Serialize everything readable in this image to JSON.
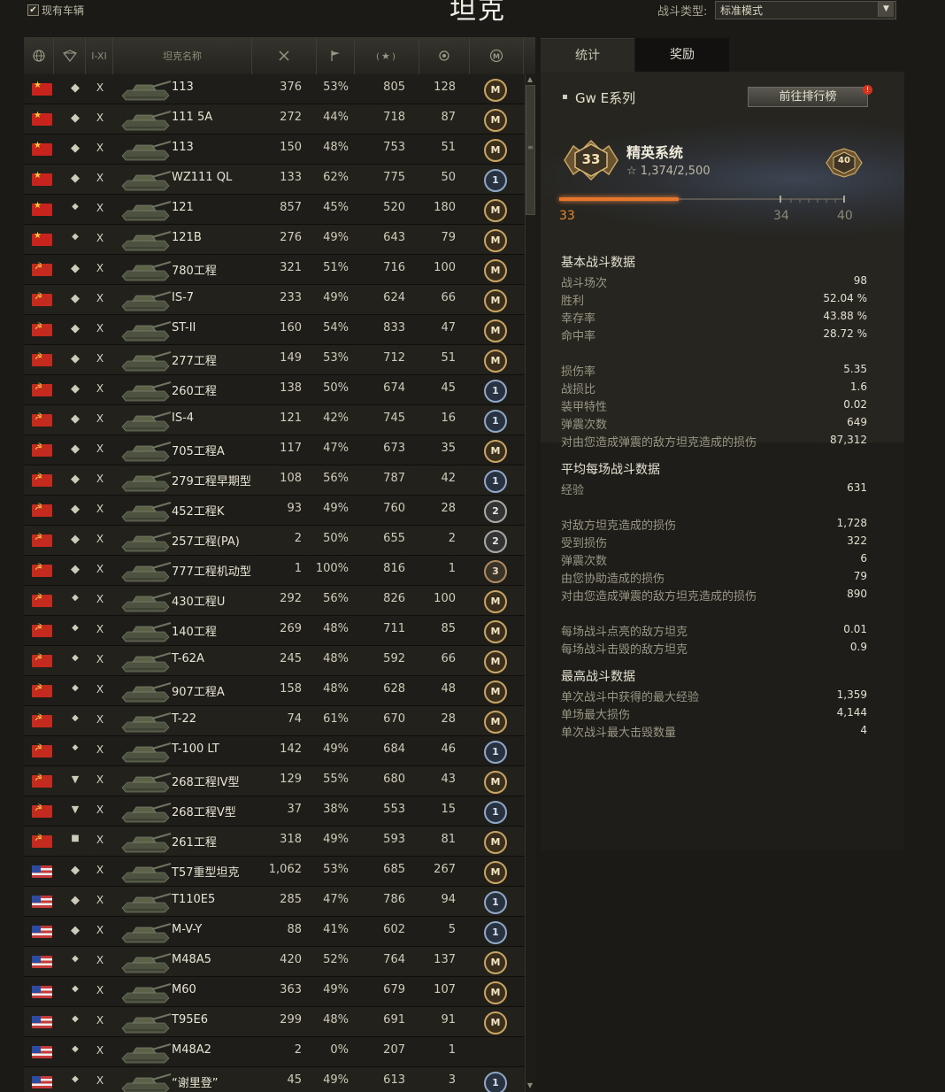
{
  "header": {
    "owned_only_label": "现有车辆",
    "owned_only_checked": "✔",
    "page_title": "坦克",
    "battle_type_label": "战斗类型:",
    "battle_type_value": "标准模式"
  },
  "table": {
    "columns": [
      "nation-globe-icon",
      "class-filter-icon",
      "I-XI",
      "坦克名称",
      "battles-icon",
      "win-flag-icon",
      "avg-xp-icon",
      "mastery-count-icon",
      "mastery-badge-icon"
    ],
    "tier_header": "I-XI",
    "name_header": "坦克名称",
    "rows": [
      {
        "nation": "china",
        "class": "heavy",
        "tier": "X",
        "name": "113",
        "battles": "376",
        "win": "53%",
        "xp": "805",
        "mastery": "128",
        "badge": "M"
      },
      {
        "nation": "china",
        "class": "heavy",
        "tier": "X",
        "name": "111 5A",
        "battles": "272",
        "win": "44%",
        "xp": "718",
        "mastery": "87",
        "badge": "M"
      },
      {
        "nation": "china",
        "class": "heavy",
        "tier": "X",
        "name": "113",
        "battles": "150",
        "win": "48%",
        "xp": "753",
        "mastery": "51",
        "badge": "M"
      },
      {
        "nation": "china",
        "class": "heavy",
        "tier": "X",
        "name": "WZ111 QL",
        "battles": "133",
        "win": "62%",
        "xp": "775",
        "mastery": "50",
        "badge": "1"
      },
      {
        "nation": "china",
        "class": "medium",
        "tier": "X",
        "name": "121",
        "battles": "857",
        "win": "45%",
        "xp": "520",
        "mastery": "180",
        "badge": "M"
      },
      {
        "nation": "china",
        "class": "medium",
        "tier": "X",
        "name": "121B",
        "battles": "276",
        "win": "49%",
        "xp": "643",
        "mastery": "79",
        "badge": "M"
      },
      {
        "nation": "ussr",
        "class": "heavy",
        "tier": "X",
        "name": "780工程",
        "battles": "321",
        "win": "51%",
        "xp": "716",
        "mastery": "100",
        "badge": "M"
      },
      {
        "nation": "ussr",
        "class": "heavy",
        "tier": "X",
        "name": "IS-7",
        "battles": "233",
        "win": "49%",
        "xp": "624",
        "mastery": "66",
        "badge": "M"
      },
      {
        "nation": "ussr",
        "class": "heavy",
        "tier": "X",
        "name": "ST-II",
        "battles": "160",
        "win": "54%",
        "xp": "833",
        "mastery": "47",
        "badge": "M"
      },
      {
        "nation": "ussr",
        "class": "heavy",
        "tier": "X",
        "name": "277工程",
        "battles": "149",
        "win": "53%",
        "xp": "712",
        "mastery": "51",
        "badge": "M"
      },
      {
        "nation": "ussr",
        "class": "heavy",
        "tier": "X",
        "name": "260工程",
        "battles": "138",
        "win": "50%",
        "xp": "674",
        "mastery": "45",
        "badge": "1"
      },
      {
        "nation": "ussr",
        "class": "heavy",
        "tier": "X",
        "name": "IS-4",
        "battles": "121",
        "win": "42%",
        "xp": "745",
        "mastery": "16",
        "badge": "1"
      },
      {
        "nation": "ussr",
        "class": "heavy",
        "tier": "X",
        "name": "705工程A",
        "battles": "117",
        "win": "47%",
        "xp": "673",
        "mastery": "35",
        "badge": "M"
      },
      {
        "nation": "ussr",
        "class": "heavy",
        "tier": "X",
        "name": "279工程早期型",
        "battles": "108",
        "win": "56%",
        "xp": "787",
        "mastery": "42",
        "badge": "1"
      },
      {
        "nation": "ussr",
        "class": "heavy",
        "tier": "X",
        "name": "452工程K",
        "battles": "93",
        "win": "49%",
        "xp": "760",
        "mastery": "28",
        "badge": "2"
      },
      {
        "nation": "ussr",
        "class": "heavy",
        "tier": "X",
        "name": "257工程(PA)",
        "battles": "2",
        "win": "50%",
        "xp": "655",
        "mastery": "2",
        "badge": "2"
      },
      {
        "nation": "ussr",
        "class": "heavy",
        "tier": "X",
        "name": "777工程机动型",
        "battles": "1",
        "win": "100%",
        "xp": "816",
        "mastery": "1",
        "badge": "3"
      },
      {
        "nation": "ussr",
        "class": "medium",
        "tier": "X",
        "name": "430工程U",
        "battles": "292",
        "win": "56%",
        "xp": "826",
        "mastery": "100",
        "badge": "M"
      },
      {
        "nation": "ussr",
        "class": "medium",
        "tier": "X",
        "name": "140工程",
        "battles": "269",
        "win": "48%",
        "xp": "711",
        "mastery": "85",
        "badge": "M"
      },
      {
        "nation": "ussr",
        "class": "medium",
        "tier": "X",
        "name": "T-62A",
        "battles": "245",
        "win": "48%",
        "xp": "592",
        "mastery": "66",
        "badge": "M"
      },
      {
        "nation": "ussr",
        "class": "medium",
        "tier": "X",
        "name": "907工程A",
        "battles": "158",
        "win": "48%",
        "xp": "628",
        "mastery": "48",
        "badge": "M"
      },
      {
        "nation": "ussr",
        "class": "medium",
        "tier": "X",
        "name": "T-22",
        "battles": "74",
        "win": "61%",
        "xp": "670",
        "mastery": "28",
        "badge": "M"
      },
      {
        "nation": "ussr",
        "class": "light",
        "tier": "X",
        "name": "T-100 LT",
        "battles": "142",
        "win": "49%",
        "xp": "684",
        "mastery": "46",
        "badge": "1"
      },
      {
        "nation": "ussr",
        "class": "td",
        "tier": "X",
        "name": "268工程IV型",
        "battles": "129",
        "win": "55%",
        "xp": "680",
        "mastery": "43",
        "badge": "M"
      },
      {
        "nation": "ussr",
        "class": "td",
        "tier": "X",
        "name": "268工程V型",
        "battles": "37",
        "win": "38%",
        "xp": "553",
        "mastery": "15",
        "badge": "1"
      },
      {
        "nation": "ussr",
        "class": "spg",
        "tier": "X",
        "name": "261工程",
        "battles": "318",
        "win": "49%",
        "xp": "593",
        "mastery": "81",
        "badge": "M"
      },
      {
        "nation": "usa",
        "class": "heavy",
        "tier": "X",
        "name": "T57重型坦克",
        "battles": "1,062",
        "win": "53%",
        "xp": "685",
        "mastery": "267",
        "badge": "M"
      },
      {
        "nation": "usa",
        "class": "heavy",
        "tier": "X",
        "name": "T110E5",
        "battles": "285",
        "win": "47%",
        "xp": "786",
        "mastery": "94",
        "badge": "1"
      },
      {
        "nation": "usa",
        "class": "heavy",
        "tier": "X",
        "name": "M-V-Y",
        "battles": "88",
        "win": "41%",
        "xp": "602",
        "mastery": "5",
        "badge": "1"
      },
      {
        "nation": "usa",
        "class": "medium",
        "tier": "X",
        "name": "M48A5",
        "battles": "420",
        "win": "52%",
        "xp": "764",
        "mastery": "137",
        "badge": "M"
      },
      {
        "nation": "usa",
        "class": "medium",
        "tier": "X",
        "name": "M60",
        "battles": "363",
        "win": "49%",
        "xp": "679",
        "mastery": "107",
        "badge": "M"
      },
      {
        "nation": "usa",
        "class": "medium",
        "tier": "X",
        "name": "T95E6",
        "battles": "299",
        "win": "48%",
        "xp": "691",
        "mastery": "91",
        "badge": "M"
      },
      {
        "nation": "usa",
        "class": "medium",
        "tier": "X",
        "name": "M48A2",
        "battles": "2",
        "win": "0%",
        "xp": "207",
        "mastery": "1",
        "badge": ""
      },
      {
        "nation": "usa",
        "class": "medium",
        "tier": "X",
        "name": "“谢里登”",
        "battles": "45",
        "win": "49%",
        "xp": "613",
        "mastery": "3",
        "badge": "1"
      }
    ]
  },
  "right_panel": {
    "tabs": [
      "统计",
      "奖励"
    ],
    "series_name": "Gw E系列",
    "ranking_button": "前往排行榜",
    "notification_count": "!",
    "elite": {
      "title": "精英系统",
      "current_level": "33",
      "points_text": "☆ 1,374/2,500",
      "next_level": "40",
      "progress_fraction": 0.42,
      "marker_start": "33",
      "marker_mid": "34",
      "marker_end": "40"
    },
    "basic_title": "基本战斗数据",
    "basic_stats": [
      {
        "label": "战斗场次",
        "value": "98"
      },
      {
        "label": "胜利",
        "value": "52.04 %"
      },
      {
        "label": "幸存率",
        "value": "43.88 %"
      },
      {
        "label": "命中率",
        "value": "28.72 %"
      },
      {
        "label": "损伤率",
        "value": "5.35"
      },
      {
        "label": "战损比",
        "value": "1.6"
      },
      {
        "label": "装甲特性",
        "value": "0.02"
      },
      {
        "label": "弹震次数",
        "value": "649"
      },
      {
        "label": "对由您造成弹震的敌方坦克造成的损伤",
        "value": "87,312"
      }
    ],
    "avg_title": "平均每场战斗数据",
    "avg_stats": [
      {
        "label": "经验",
        "value": "631"
      },
      {
        "label": "对敌方坦克造成的损伤",
        "value": "1,728"
      },
      {
        "label": "受到损伤",
        "value": "322"
      },
      {
        "label": "弹震次数",
        "value": "6"
      },
      {
        "label": "由您协助造成的损伤",
        "value": "79"
      },
      {
        "label": "对由您造成弹震的敌方坦克造成的损伤",
        "value": "890"
      },
      {
        "label": "每场战斗点亮的敌方坦克",
        "value": "0.01"
      },
      {
        "label": "每场战斗击毁的敌方坦克",
        "value": "0.9"
      }
    ],
    "max_title": "最高战斗数据",
    "max_stats": [
      {
        "label": "单次战斗中获得的最大经验",
        "value": "1,359"
      },
      {
        "label": "单场最大损伤",
        "value": "4,144"
      },
      {
        "label": "单次战斗最大击毁数量",
        "value": "4"
      }
    ]
  },
  "colors": {
    "accent_orange": "#e5762c",
    "mastery_gold": "#c9a462"
  }
}
